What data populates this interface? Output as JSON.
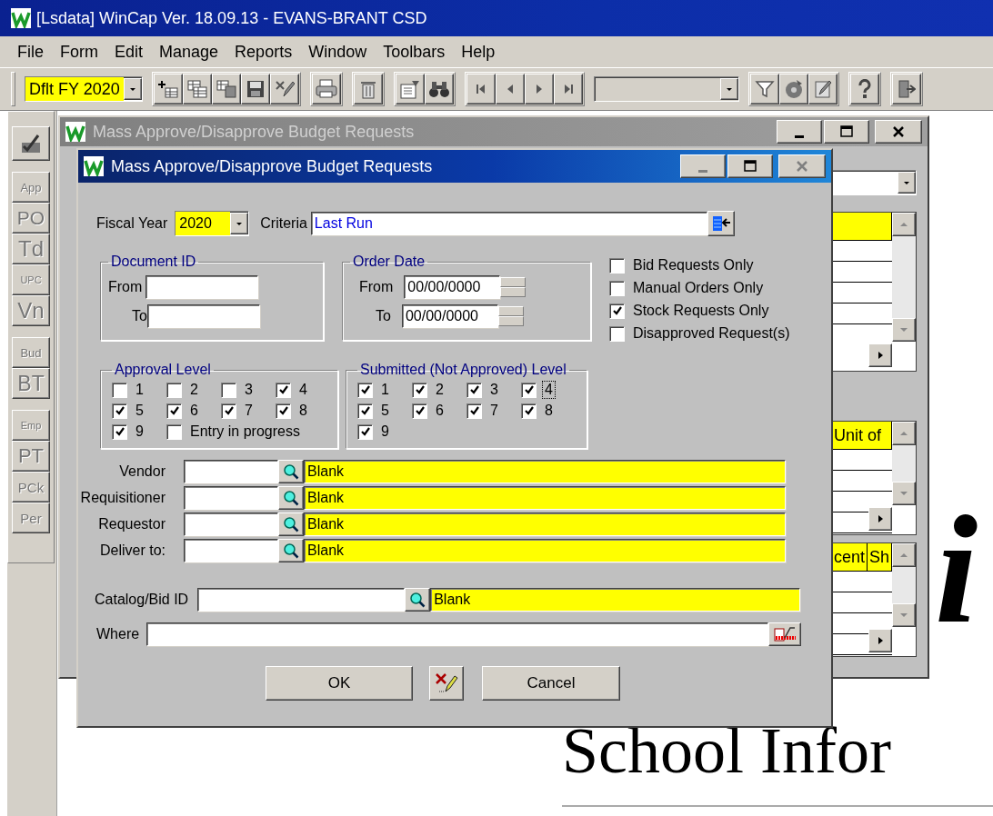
{
  "app_title": "[Lsdata] WinCap Ver. 18.09.13 - EVANS-BRANT CSD",
  "menu": [
    "File",
    "Form",
    "Edit",
    "Manage",
    "Reports",
    "Window",
    "Toolbars",
    "Help"
  ],
  "toolbar": {
    "year_combo": "Dflt FY 2020"
  },
  "side_toolbar": {
    "groups": [
      {
        "items": [
          {
            "label": "App",
            "disabled": true
          },
          {
            "label": "PO",
            "disabled": true
          },
          {
            "label": "Td",
            "disabled": true
          },
          {
            "label": "UPC",
            "disabled": true
          },
          {
            "label": "Vn",
            "disabled": true
          }
        ]
      },
      {
        "items": [
          {
            "label": "Bud",
            "disabled": true
          },
          {
            "label": "BT",
            "disabled": true
          }
        ]
      },
      {
        "items": [
          {
            "label": "Emp",
            "disabled": true
          },
          {
            "label": "PT",
            "disabled": true
          },
          {
            "label": "PCk",
            "disabled": true
          },
          {
            "label": "Per",
            "disabled": true
          }
        ]
      }
    ]
  },
  "back_window": {
    "title": "Mass Approve/Disapprove Budget Requests",
    "active": false,
    "grid_2": {
      "columns": [
        "Unit of"
      ]
    },
    "grid_3": {
      "columns": [
        "cent",
        "Sh"
      ]
    }
  },
  "background": {
    "heading": "School Infor",
    "italic_text": "i"
  },
  "dialog": {
    "title": "Mass Approve/Disapprove Budget Requests",
    "active": true,
    "fiscal_year": {
      "label": "Fiscal Year",
      "value": "2020"
    },
    "criteria": {
      "label": "Criteria",
      "value": "Last Run"
    },
    "document_id": {
      "title": "Document ID",
      "from_label": "From",
      "to_label": "To"
    },
    "order_date": {
      "title": "Order Date",
      "from_label": "From",
      "from_value": "00/00/0000",
      "to_label": "To",
      "to_value": "00/00/0000"
    },
    "options": [
      {
        "label": "Bid Requests Only",
        "checked": false
      },
      {
        "label": "Manual Orders Only",
        "checked": false
      },
      {
        "label": "Stock Requests Only",
        "checked": true
      },
      {
        "label": "Disapproved Request(s)",
        "checked": false
      }
    ],
    "approval_level": {
      "title": "Approval Level",
      "items": [
        {
          "label": "1",
          "checked": false
        },
        {
          "label": "2",
          "checked": false
        },
        {
          "label": "3",
          "checked": false
        },
        {
          "label": "4",
          "checked": true
        },
        {
          "label": "5",
          "checked": true
        },
        {
          "label": "6",
          "checked": true
        },
        {
          "label": "7",
          "checked": true
        },
        {
          "label": "8",
          "checked": true
        },
        {
          "label": "9",
          "checked": true
        },
        {
          "label": "Entry in progress",
          "checked": false
        }
      ]
    },
    "submitted_level": {
      "title": "Submitted (Not Approved) Level",
      "items": [
        {
          "label": "1",
          "checked": true,
          "focused": false
        },
        {
          "label": "2",
          "checked": true,
          "focused": false
        },
        {
          "label": "3",
          "checked": true,
          "focused": false
        },
        {
          "label": "4",
          "checked": true,
          "focused": true
        },
        {
          "label": "5",
          "checked": true,
          "focused": false
        },
        {
          "label": "6",
          "checked": true,
          "focused": false
        },
        {
          "label": "7",
          "checked": true,
          "focused": false
        },
        {
          "label": "8",
          "checked": true,
          "focused": false
        },
        {
          "label": "9",
          "checked": true,
          "focused": false
        }
      ]
    },
    "lookups": [
      {
        "label": "Vendor",
        "value": "Blank"
      },
      {
        "label": "Requisitioner",
        "value": "Blank"
      },
      {
        "label": "Requestor",
        "value": "Blank"
      },
      {
        "label": "Deliver to:",
        "value": "Blank"
      }
    ],
    "catalog": {
      "label": "Catalog/Bid ID",
      "value": "Blank"
    },
    "where": {
      "label": "Where"
    },
    "buttons": {
      "ok": "OK",
      "cancel": "Cancel"
    }
  }
}
